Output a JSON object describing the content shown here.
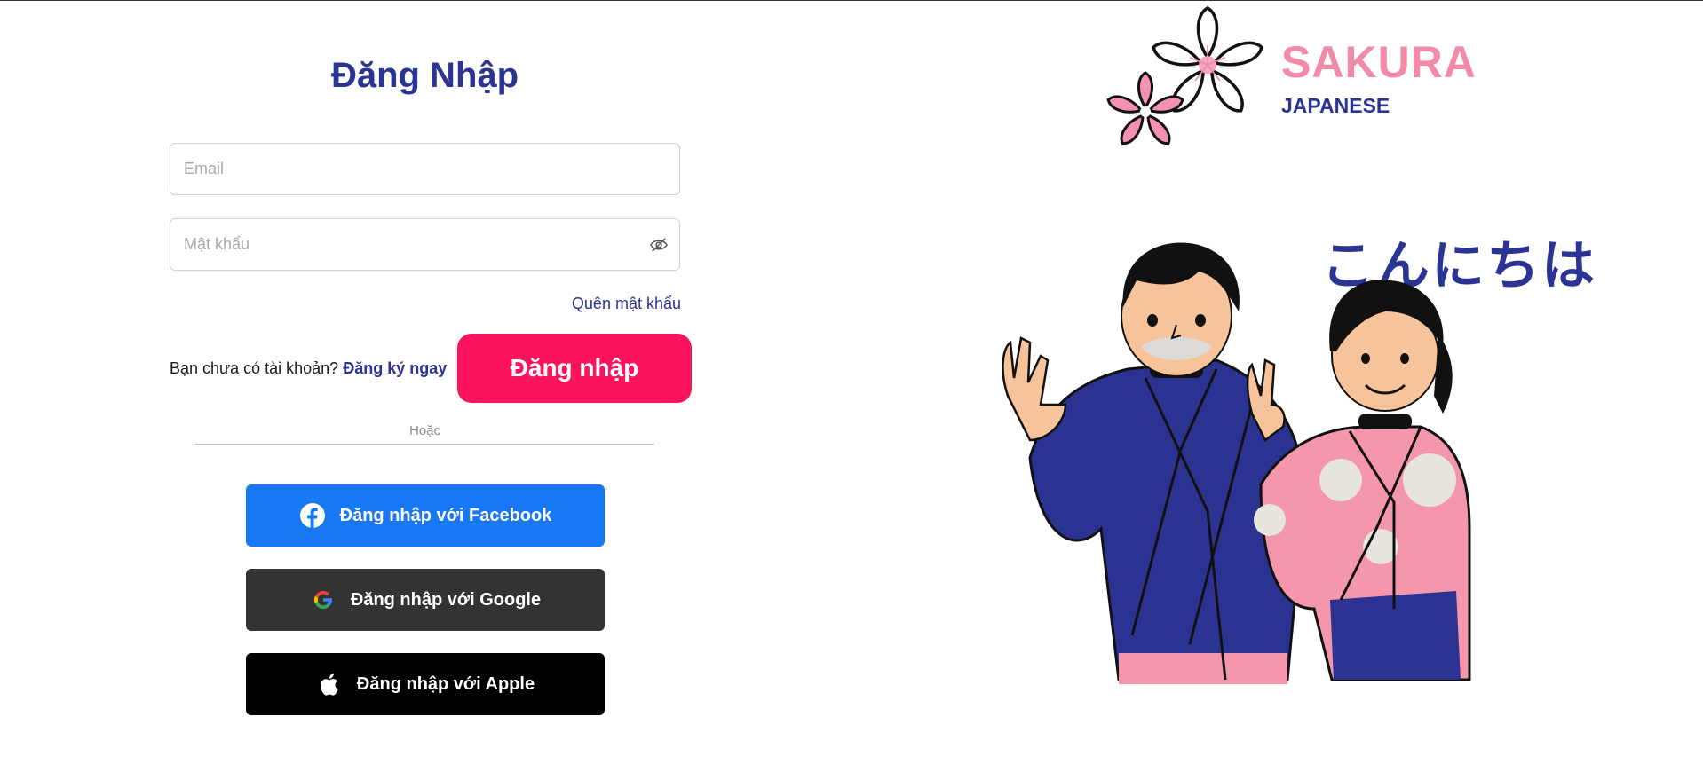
{
  "login": {
    "title": "Đăng Nhập",
    "email_placeholder": "Email",
    "password_placeholder": "Mật khẩu",
    "forgot_password": "Quên mật khẩu",
    "no_account_text": "Bạn chưa có tài khoản?",
    "signup_link": "Đăng ký ngay",
    "login_button": "Đăng nhập",
    "or_text": "Hoặc"
  },
  "social": {
    "facebook": "Đăng nhập với Facebook",
    "google": "Đăng nhập với Google",
    "apple": "Đăng nhập với Apple"
  },
  "brand": {
    "name": "SAKURA",
    "subtitle": "JAPANESE",
    "greeting": "こんにちは"
  },
  "colors": {
    "primary_navy": "#2b3393",
    "login_button": "#fb135d",
    "facebook": "#1877f2",
    "google": "#333333",
    "apple": "#000000",
    "sakura_pink": "#f28aa8"
  },
  "icons": {
    "password_toggle": "eye-slash-icon",
    "facebook": "facebook-icon",
    "google": "google-icon",
    "apple": "apple-icon",
    "logo": "sakura-flower-logo"
  }
}
